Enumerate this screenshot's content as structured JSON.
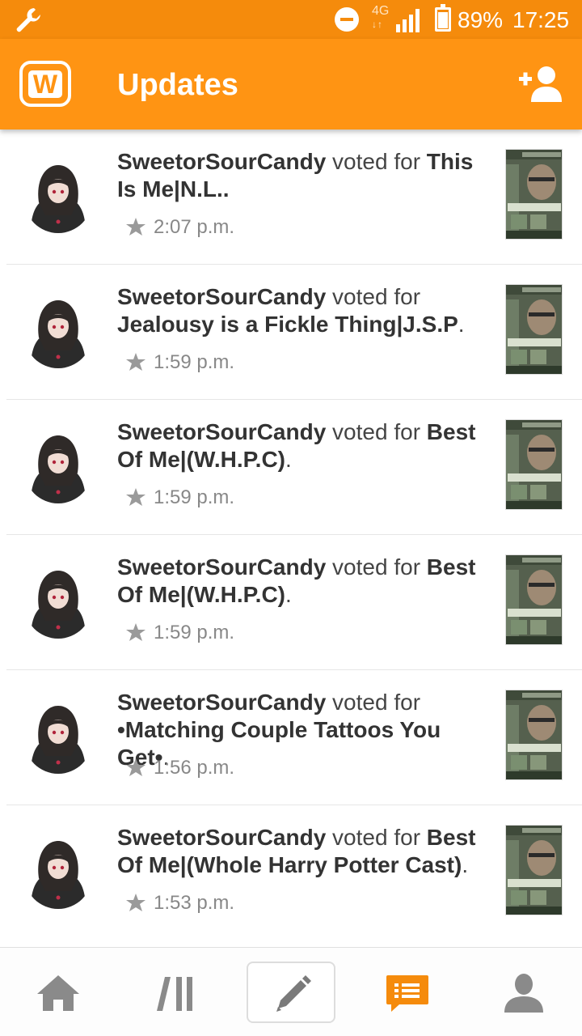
{
  "status_bar": {
    "network_type": "4G",
    "battery_percent": "89%",
    "battery_level": 0.89,
    "time": "17:25",
    "icons": [
      "wrench-icon",
      "do-not-disturb-icon",
      "signal-icon",
      "battery-icon"
    ]
  },
  "app_bar": {
    "logo_letter": "W",
    "title": "Updates",
    "action_icon": "add-user-icon"
  },
  "feed": [
    {
      "user": "SweetorSourCandy",
      "verb": " voted for ",
      "story": "This Is Me|N.L..",
      "tail": "",
      "time": "2:07 p.m."
    },
    {
      "user": "SweetorSourCandy",
      "verb": " voted for ",
      "story": "Jealousy is a Fickle Thing|J.S.P",
      "tail": ".",
      "time": "1:59 p.m."
    },
    {
      "user": "SweetorSourCandy",
      "verb": " voted for ",
      "story": "Best Of Me|(W.H.P.C)",
      "tail": ".",
      "time": "1:59 p.m."
    },
    {
      "user": "SweetorSourCandy",
      "verb": " voted for ",
      "story": "Best Of Me|(W.H.P.C)",
      "tail": ".",
      "time": "1:59 p.m."
    },
    {
      "user": "SweetorSourCandy",
      "verb": " voted for ",
      "story": "•Matching Couple Tattoos You Get•",
      "tail": ".",
      "time": "1:56 p.m."
    },
    {
      "user": "SweetorSourCandy",
      "verb": " voted for ",
      "story": "Best Of Me|(Whole Harry Potter Cast)",
      "tail": ".",
      "time": "1:53 p.m."
    }
  ],
  "bottom_nav": {
    "tabs": [
      "home-icon",
      "library-icon",
      "write-icon",
      "updates-icon",
      "profile-icon"
    ],
    "active": "updates-icon"
  },
  "colors": {
    "brand_orange": "#ff9413",
    "status_orange": "#f58b0c",
    "text_dark": "#333333",
    "text_muted": "#888888",
    "nav_icon_gray": "#8a8a8a"
  }
}
